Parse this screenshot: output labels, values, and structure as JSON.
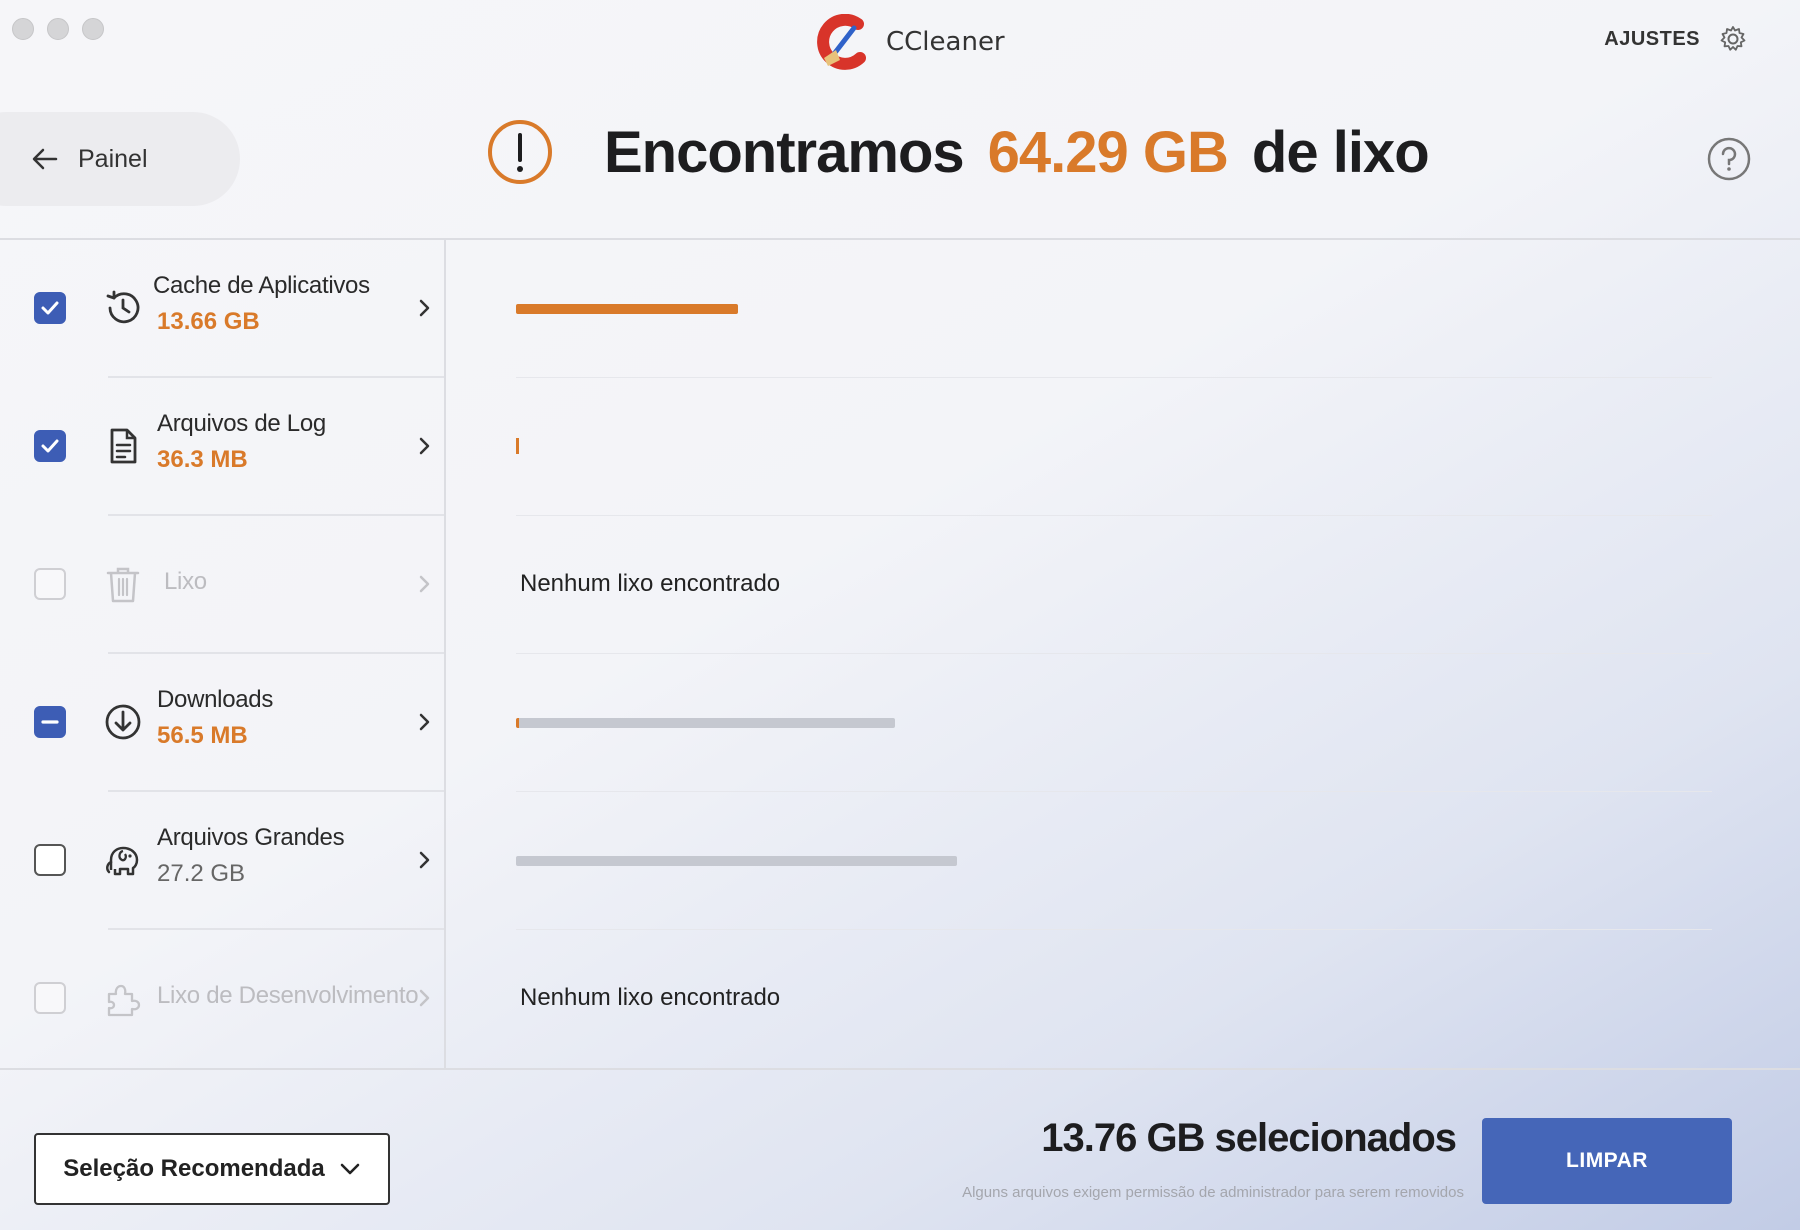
{
  "app": {
    "name": "CCleaner"
  },
  "toolbar": {
    "settings_label": "AJUSTES"
  },
  "header": {
    "back_label": "Painel",
    "headline_prefix": "Encontramos",
    "headline_amount": "64.29 GB",
    "headline_suffix": "de lixo"
  },
  "categories": [
    {
      "name": "Cache de Aplicativos",
      "size": "13.66 GB",
      "state": "checked",
      "icon": "history-icon",
      "bar": {
        "fraction": 0.186,
        "color": "orange"
      }
    },
    {
      "name": "Arquivos de Log",
      "size": "36.3 MB",
      "state": "checked",
      "icon": "document-icon",
      "bar": {
        "fraction": 0.001,
        "color": "orange"
      }
    },
    {
      "name": "Lixo",
      "size": "",
      "state": "disabled",
      "icon": "trash-icon",
      "message": "Nenhum lixo encontrado"
    },
    {
      "name": "Downloads",
      "size": "56.5 MB",
      "state": "partial",
      "icon": "download-icon",
      "bar": {
        "fraction": 0.317,
        "color": "grey"
      }
    },
    {
      "name": "Arquivos Grandes",
      "size": "27.2 GB",
      "state": "unchecked",
      "icon": "elephant-icon",
      "bar": {
        "fraction": 0.369,
        "color": "grey"
      }
    },
    {
      "name": "Lixo de Desenvolvimento",
      "size": "",
      "state": "disabled",
      "icon": "puzzle-icon",
      "message": "Nenhum lixo encontrado"
    }
  ],
  "footer": {
    "selection_mode": "Seleção Recomendada",
    "selected_total": "13.76 GB selecionados",
    "admin_note": "Alguns arquivos exigem permissão de administrador para serem removidos",
    "clean_label": "LIMPAR"
  },
  "colors": {
    "accent": "#3d5db5",
    "amount": "#d97a2a",
    "button": "#4566b8"
  }
}
